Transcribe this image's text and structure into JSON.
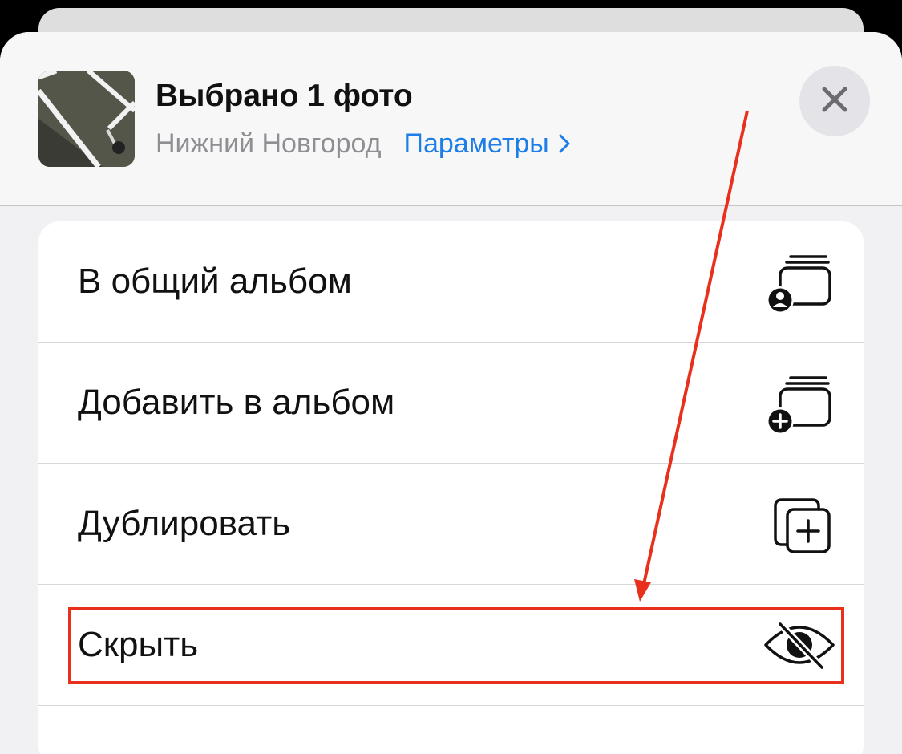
{
  "header": {
    "title": "Выбрано 1 фото",
    "location": "Нижний Новгород",
    "params_link": "Параметры",
    "thumbnail": "photo-thumbnail",
    "close_icon": "close-icon"
  },
  "menu": {
    "items": [
      {
        "label": "В общий альбом",
        "icon": "shared-album-icon"
      },
      {
        "label": "Добавить в альбом",
        "icon": "add-to-album-icon"
      },
      {
        "label": "Дублировать",
        "icon": "duplicate-icon"
      },
      {
        "label": "Скрыть",
        "icon": "hide-eye-slash-icon"
      }
    ]
  },
  "annotation": {
    "color": "#e8301c",
    "highlighted_item": "Скрыть"
  },
  "colors": {
    "accent": "#1c7ee6",
    "secondary_text": "#8e8e93"
  }
}
